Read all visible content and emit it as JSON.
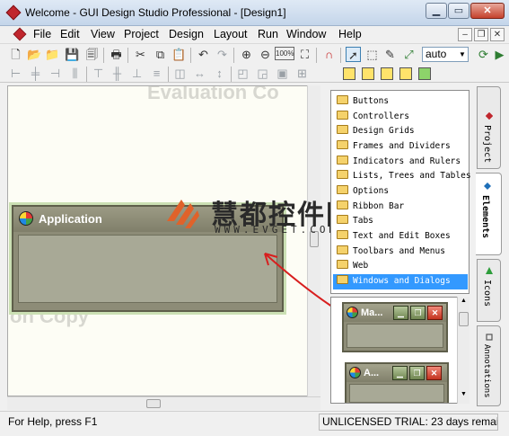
{
  "window": {
    "title": "Welcome - GUI Design Studio Professional - [Design1]"
  },
  "menu": [
    "File",
    "Edit",
    "View",
    "Project",
    "Design",
    "Layout",
    "Run",
    "Window",
    "Help"
  ],
  "toolbar": {
    "zoom_value": "auto",
    "zoom_percent_label": "100%"
  },
  "canvas": {
    "watermark_top": "Evaluation Co",
    "watermark_left": "on Copy",
    "design_window_title": "Application"
  },
  "overlay": {
    "logo_text": "慧都控件网",
    "logo_url": "WWW.EVGET.COM"
  },
  "elements_panel": {
    "items": [
      "Buttons",
      "Controllers",
      "Design Grids",
      "Frames and Dividers",
      "Indicators and Rulers",
      "Lists, Trees and Tables",
      "Options",
      "Ribbon Bar",
      "Tabs",
      "Text and Edit Boxes",
      "Toolbars and Menus",
      "Web",
      "Windows and Dialogs"
    ],
    "selected": "Windows and Dialogs"
  },
  "preview": {
    "window1_title": "Ma...",
    "window2_title": "A..."
  },
  "side_tabs": [
    "Project",
    "Elements",
    "Icons",
    "Annotations"
  ],
  "status": {
    "help": "For Help, press F1",
    "license": "UNLICENSED TRIAL: 23 days remai"
  },
  "colors": {
    "selection": "#3399ff",
    "design_frame": "#8d8c77",
    "annotation_arrow": "#d81e1e"
  }
}
